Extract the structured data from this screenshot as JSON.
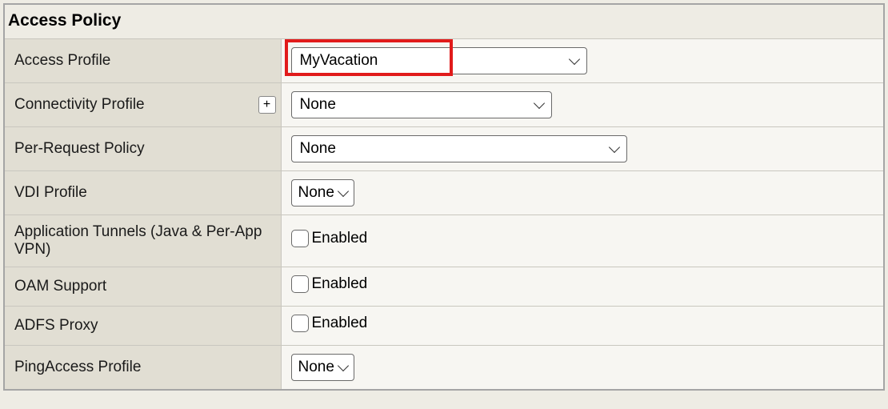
{
  "panel": {
    "title": "Access Policy"
  },
  "rows": {
    "access_profile": {
      "label": "Access Profile",
      "value": "MyVacation"
    },
    "connectivity_profile": {
      "label": "Connectivity Profile",
      "value": "None",
      "add": "+"
    },
    "per_request_policy": {
      "label": "Per-Request Policy",
      "value": "None"
    },
    "vdi_profile": {
      "label": "VDI Profile",
      "value": "None"
    },
    "app_tunnels": {
      "label": "Application Tunnels (Java & Per-App VPN)",
      "value": "Enabled"
    },
    "oam_support": {
      "label": "OAM Support",
      "value": "Enabled"
    },
    "adfs_proxy": {
      "label": "ADFS Proxy",
      "value": "Enabled"
    },
    "pingaccess_profile": {
      "label": "PingAccess Profile",
      "value": "None"
    }
  }
}
